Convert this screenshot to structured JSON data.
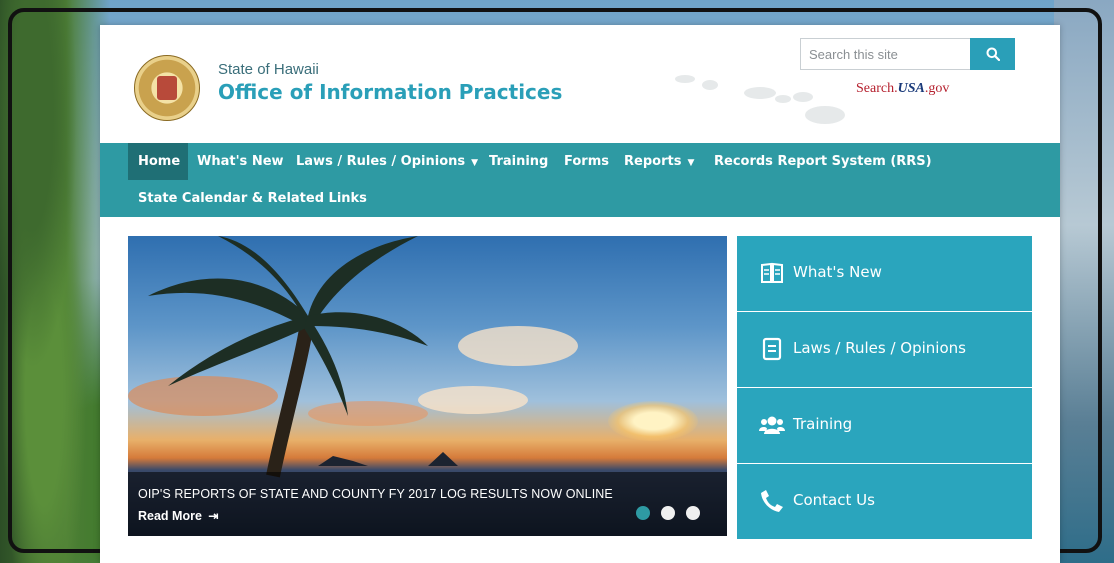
{
  "header": {
    "state_label": "State of Hawaii",
    "office_title": "Office of Information Practices"
  },
  "search": {
    "placeholder": "Search this site",
    "button_icon": "search-icon",
    "usagov": {
      "pre": "Search.",
      "mid": "USA",
      "post": ".gov"
    }
  },
  "nav": {
    "items": [
      {
        "label": "Home",
        "active": true
      },
      {
        "label": "What's New"
      },
      {
        "label": "Laws / Rules / Opinions",
        "dropdown": true
      },
      {
        "label": "Training"
      },
      {
        "label": "Forms"
      },
      {
        "label": "Reports",
        "dropdown": true
      },
      {
        "label": "Records Report System (RRS)"
      },
      {
        "label": "State Calendar & Related Links"
      }
    ]
  },
  "hero": {
    "caption": "OIP'S REPORTS OF STATE AND COUNTY FY 2017 LOG RESULTS NOW ONLINE",
    "read_more": "Read More",
    "read_more_icon": "sign-in-icon",
    "slides": 3,
    "active_slide": 1
  },
  "sidebar": {
    "items": [
      {
        "label": "What's New",
        "icon": "book-icon"
      },
      {
        "label": "Laws / Rules / Opinions",
        "icon": "document-icon"
      },
      {
        "label": "Training",
        "icon": "users-icon"
      },
      {
        "label": "Contact Us",
        "icon": "phone-icon"
      }
    ]
  },
  "colors": {
    "brand_teal": "#2e9aa3",
    "nav_active": "#1f6f75",
    "title_blue": "#2a9fb8",
    "sidebar_blue": "#2aa5bd"
  }
}
